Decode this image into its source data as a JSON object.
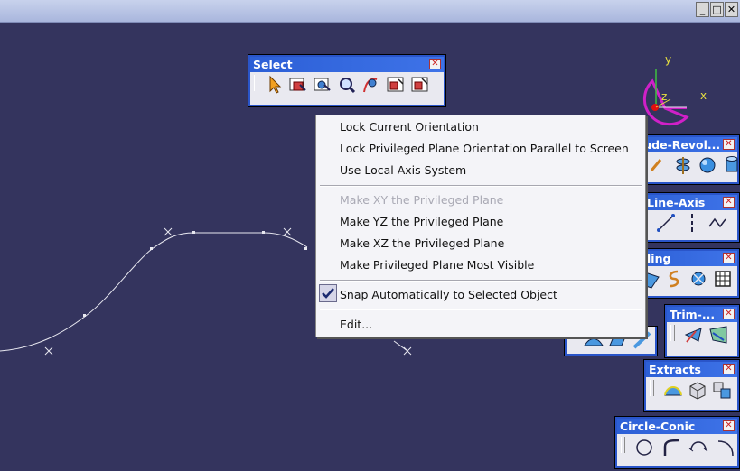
{
  "window": {
    "controls": [
      "_",
      "□",
      "✕"
    ]
  },
  "axes": {
    "x": "x",
    "y": "y",
    "z": "z"
  },
  "toolbars": {
    "select": {
      "title": "Select",
      "close": "✕"
    },
    "extrude": {
      "title": "...ude-Revol...",
      "close": "✕"
    },
    "line_axis": {
      "title": "Line-Axis",
      "close": "✕"
    },
    "ling": {
      "title": "ling",
      "close": "✕"
    },
    "trim": {
      "title": "Trim-...",
      "close": "✕"
    },
    "extracts": {
      "title": "Extracts",
      "close": "✕"
    },
    "circle_conic": {
      "title": "Circle-Conic",
      "close": "✕"
    }
  },
  "context_menu": {
    "items": [
      {
        "label": "Lock Current Orientation",
        "enabled": true
      },
      {
        "label": "Lock Privileged Plane Orientation Parallel to Screen",
        "enabled": true
      },
      {
        "label": "Use Local Axis System",
        "enabled": true
      },
      {
        "label": "Make XY the Privileged Plane",
        "enabled": false
      },
      {
        "label": "Make YZ the Privileged Plane",
        "enabled": true
      },
      {
        "label": "Make XZ the Privileged Plane",
        "enabled": true
      },
      {
        "label": "Make Privileged Plane Most Visible",
        "enabled": true
      },
      {
        "label": "Snap Automatically to Selected Object",
        "enabled": true,
        "checked": true
      },
      {
        "label": "Edit...",
        "enabled": true
      }
    ]
  }
}
